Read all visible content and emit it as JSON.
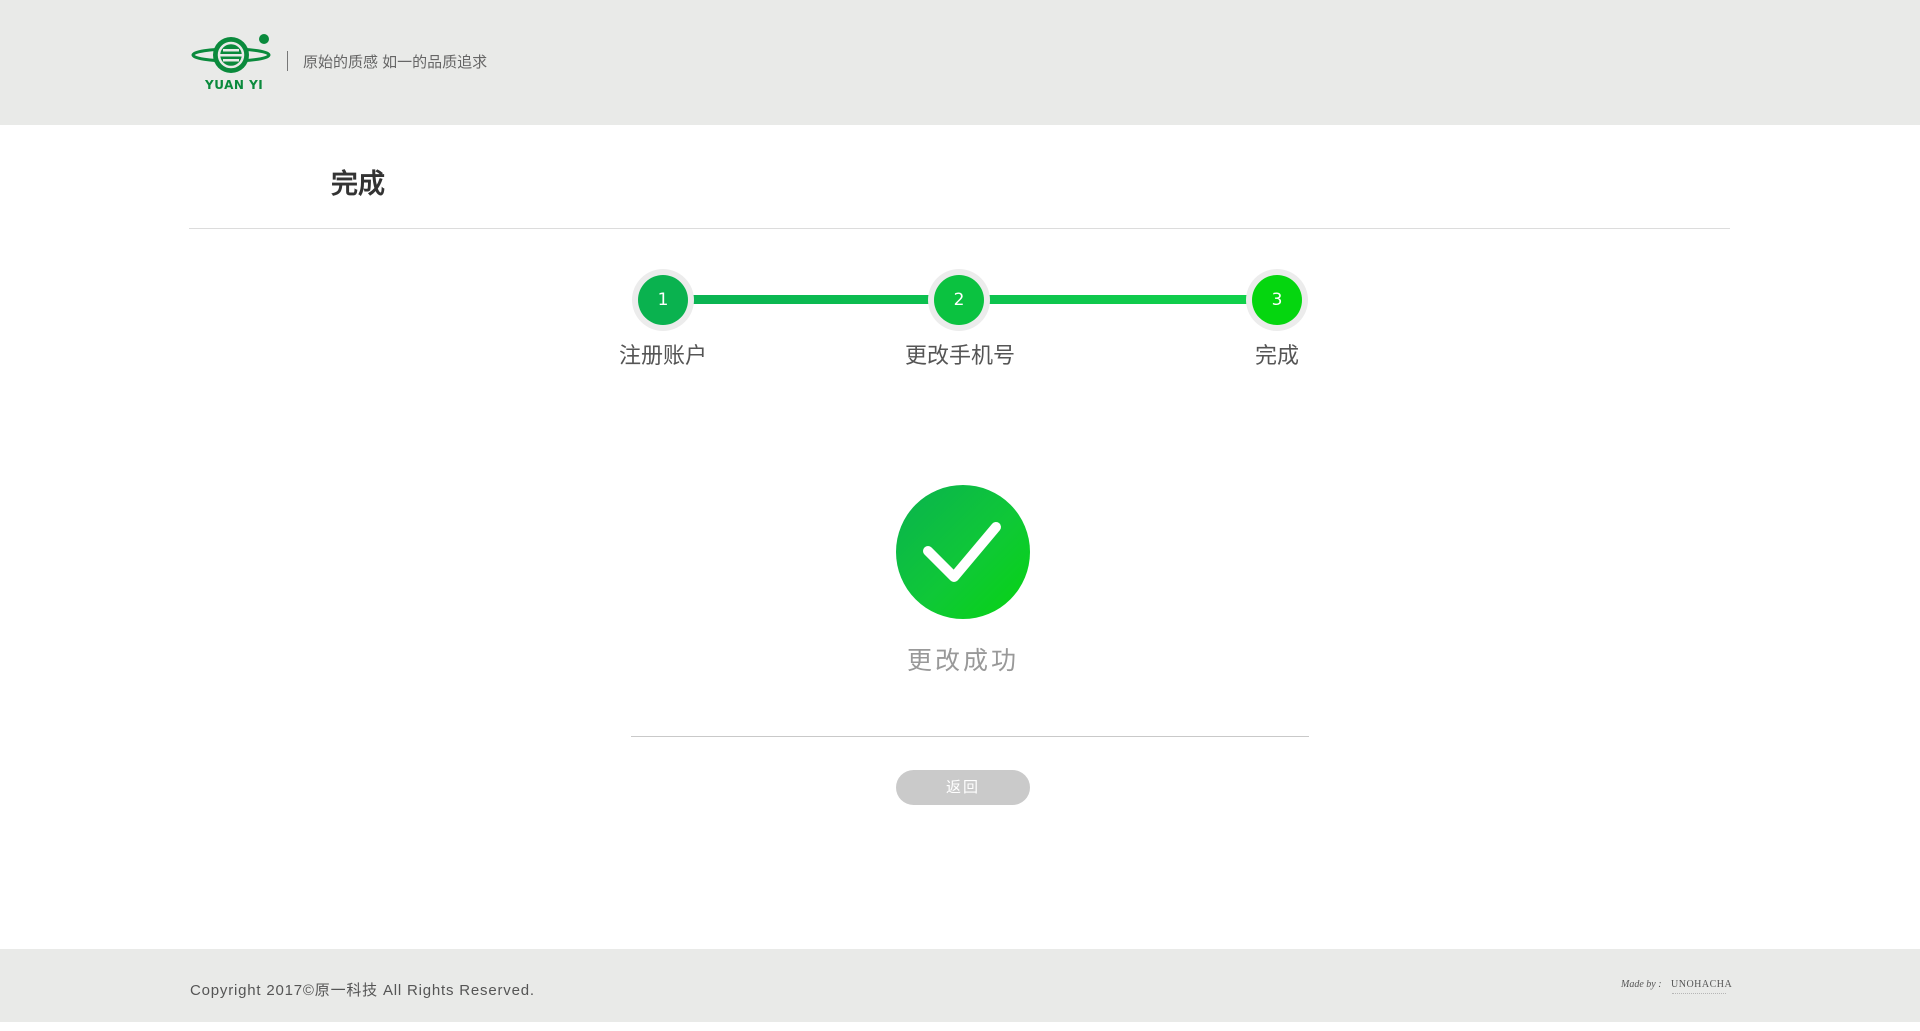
{
  "header": {
    "logo_text": "YUAN YI",
    "slogan": "原始的质感 如一的品质追求"
  },
  "page": {
    "title": "完成"
  },
  "steps": [
    {
      "number": "1",
      "label": "注册账户",
      "color": "#0ab24f"
    },
    {
      "number": "2",
      "label": "更改手机号",
      "color": "#0bc240"
    },
    {
      "number": "3",
      "label": "完成",
      "color": "#05d60f"
    }
  ],
  "result": {
    "icon": "check-icon",
    "message": "更改成功"
  },
  "actions": {
    "back_label": "返回"
  },
  "footer": {
    "copyright": "Copyright 2017©原一科技 All Rights Reserved.",
    "made_by_prefix": "Made by :",
    "made_by_brand": "UNOHACHA"
  },
  "colors": {
    "brand_green": "#0a8a3c",
    "step_start": "#0ab24f",
    "step_end": "#05d60f",
    "header_bg": "#e9eae8",
    "button_bg": "#cacaca"
  }
}
